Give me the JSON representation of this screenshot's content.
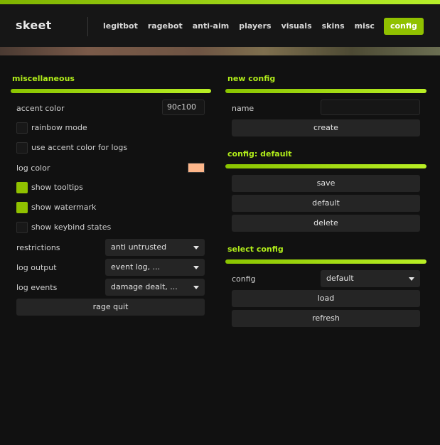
{
  "app": {
    "logo": "skeet"
  },
  "nav": {
    "tabs": [
      "legitbot",
      "ragebot",
      "anti-aim",
      "players",
      "visuals",
      "skins",
      "misc",
      "config"
    ],
    "active": "config"
  },
  "colors": {
    "accent": "#90c100",
    "log_color": "#fdb68a"
  },
  "misc": {
    "title": "miscellaneous",
    "accent_color_label": "accent color",
    "accent_color_value": "90c100",
    "rainbow_mode": {
      "label": "rainbow mode",
      "checked": false
    },
    "use_accent_for_logs": {
      "label": "use accent color for logs",
      "checked": false
    },
    "log_color_label": "log color",
    "show_tooltips": {
      "label": "show tooltips",
      "checked": true
    },
    "show_watermark": {
      "label": "show watermark",
      "checked": true
    },
    "show_keybind_states": {
      "label": "show keybind states",
      "checked": false
    },
    "restrictions": {
      "label": "restrictions",
      "value": "anti untrusted"
    },
    "log_output": {
      "label": "log output",
      "value": "event log, ..."
    },
    "log_events": {
      "label": "log events",
      "value": "damage dealt, ..."
    },
    "rage_quit": "rage quit"
  },
  "new_config": {
    "title": "new config",
    "name_label": "name",
    "name_value": "",
    "create": "create"
  },
  "config_default": {
    "title": "config: default",
    "save": "save",
    "default": "default",
    "delete": "delete"
  },
  "select_config": {
    "title": "select config",
    "config_label": "config",
    "config_value": "default",
    "load": "load",
    "refresh": "refresh"
  }
}
